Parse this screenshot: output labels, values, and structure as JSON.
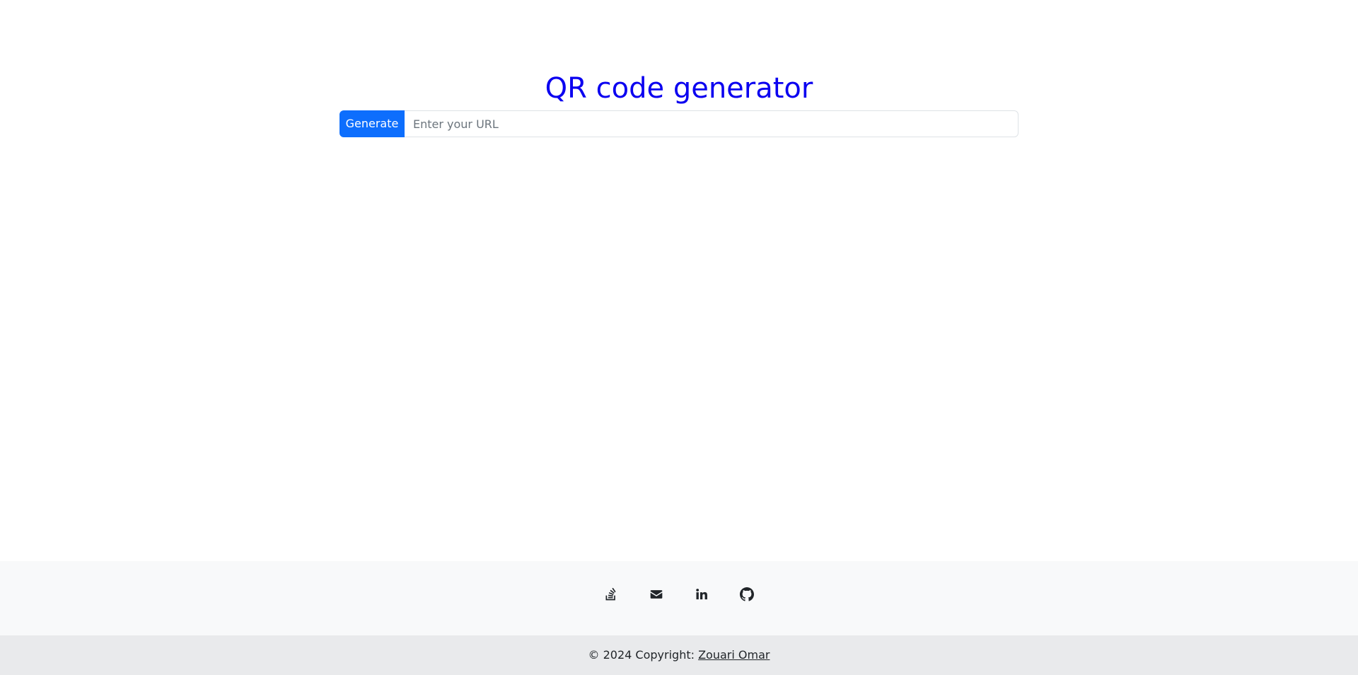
{
  "page": {
    "title": "QR code generator"
  },
  "form": {
    "generate_label": "Generate",
    "url_placeholder": "Enter your URL",
    "url_value": ""
  },
  "footer": {
    "icons": [
      "stack-overflow-icon",
      "envelope-icon",
      "linkedin-icon",
      "github-icon"
    ],
    "copyright_prefix": "© 2024 Copyright: ",
    "author_link": "Zouari Omar"
  },
  "colors": {
    "title": "#0b00f0",
    "button": "#0d6efd",
    "footer_bg": "#f8f9fa",
    "copyright_bg": "#e9eaec"
  }
}
